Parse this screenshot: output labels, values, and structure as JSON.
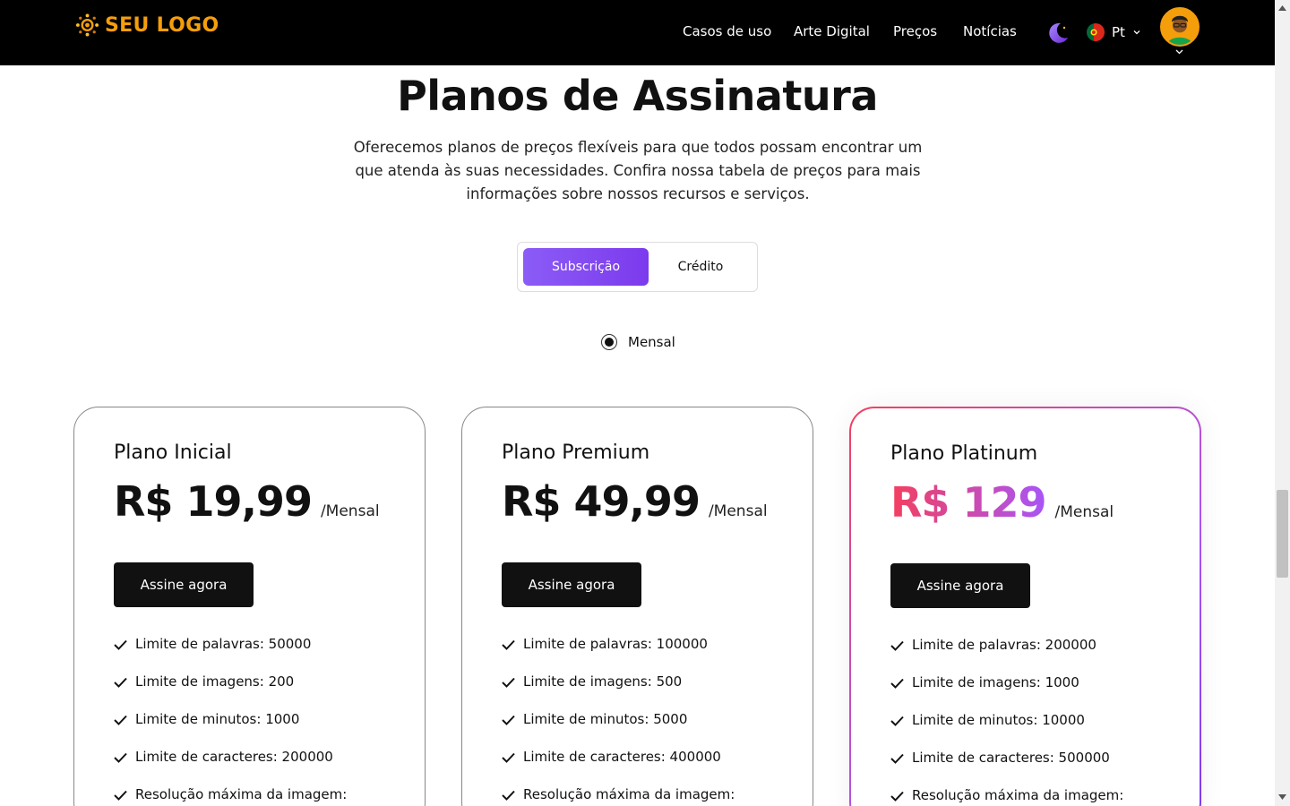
{
  "header": {
    "logo_text": "SEU LOGO",
    "nav": [
      {
        "label": "Casos de uso"
      },
      {
        "label": "Arte Digital"
      },
      {
        "label": "Preços"
      },
      {
        "label": "Notícias"
      }
    ],
    "language": "Pt",
    "colors": {
      "background": "#000000",
      "logo": "#f59e0b",
      "accent": "#8b5cf6"
    }
  },
  "hero": {
    "title": "Planos de Assinatura",
    "description": "Oferecemos planos de preços flexíveis para que todos possam encontrar um que atenda às suas necessidades. Confira nossa tabela de preços para mais informações sobre nossos recursos e serviços."
  },
  "billing_toggle": {
    "options": [
      "Subscrição",
      "Crédito"
    ],
    "selected": "Subscrição"
  },
  "period": {
    "label": "Mensal",
    "selected": true
  },
  "plans": [
    {
      "name": "Plano Inicial",
      "price": "R$ 19,99",
      "period": "/Mensal",
      "cta": "Assine agora",
      "features": [
        "Limite de palavras: 50000",
        "Limite de imagens: 200",
        "Limite de minutos: 1000",
        "Limite de caracteres: 200000",
        "Resolução máxima da imagem:"
      ]
    },
    {
      "name": "Plano Premium",
      "price": "R$ 49,99",
      "period": "/Mensal",
      "cta": "Assine agora",
      "features": [
        "Limite de palavras: 100000",
        "Limite de imagens: 500",
        "Limite de minutos: 5000",
        "Limite de caracteres: 400000",
        "Resolução máxima da imagem:"
      ]
    },
    {
      "name": "Plano Platinum",
      "price": "R$ 129",
      "period": "/Mensal",
      "cta": "Assine agora",
      "highlighted": true,
      "features": [
        "Limite de palavras: 200000",
        "Limite de imagens: 1000",
        "Limite de minutos: 10000",
        "Limite de caracteres: 500000",
        "Resolução máxima da imagem:"
      ]
    }
  ],
  "icons": {
    "logo": "logo-icon",
    "theme": "moon-icon",
    "flag": "portugal-flag-icon",
    "caret": "chevron-down-icon",
    "check": "check-icon"
  }
}
